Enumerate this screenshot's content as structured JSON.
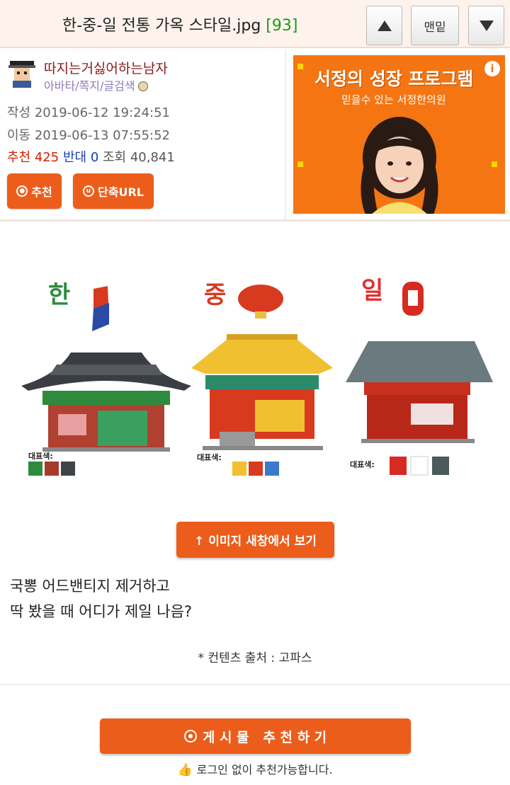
{
  "header": {
    "title": "한-중-일 전통 가옥 스타일.jpg",
    "comment_count": "[93]",
    "up_label": "▲",
    "top_label": "맨밑",
    "down_label": "▼"
  },
  "post": {
    "author": "따지는거싫어하는남자",
    "author_links": "아바타/쪽지/글검색",
    "written": "작성 2019-06-12 19:24:51",
    "moved": "이동 2019-06-13 07:55:52",
    "recommend_label": "추천",
    "recommend_count": "425",
    "oppose_label": "반대",
    "oppose_count": "0",
    "views": "조회 40,841",
    "recommend_button": "추천",
    "short_url_button": "단축URL"
  },
  "ad": {
    "headline": "서정의 성장 프로그램",
    "sub": "믿을수 있는 서정한의원",
    "info_icon": "i"
  },
  "image": {
    "houses": [
      {
        "label": "한",
        "caption": "대표색:",
        "colors": [
          "#2e8b3e",
          "#a83a2a",
          "#404448"
        ]
      },
      {
        "label": "중",
        "caption": "대표색:",
        "colors": [
          "#f0c030",
          "#d83a20",
          "#3a7ac8"
        ]
      },
      {
        "label": "일",
        "caption": "대표색:",
        "colors": [
          "#d82a20",
          "#ffffff",
          "#4a5a5a"
        ]
      }
    ]
  },
  "view_button": "↑ 이미지 새창에서 보기",
  "body": {
    "line1": "국뽕 어드밴티지 제거하고",
    "line2": "딱 봤을 때 어디가 제일 나음?",
    "source": "* 컨텐츠 출처 : 고파스"
  },
  "recommend_big_button": "게 시 물   추 천 하 기",
  "no_login_note": "로그인 없이 추천가능합니다.",
  "colors": {
    "accent": "#ec5d1b",
    "ad_bg": "#f47512",
    "header_bg": "#fdf3ec"
  }
}
